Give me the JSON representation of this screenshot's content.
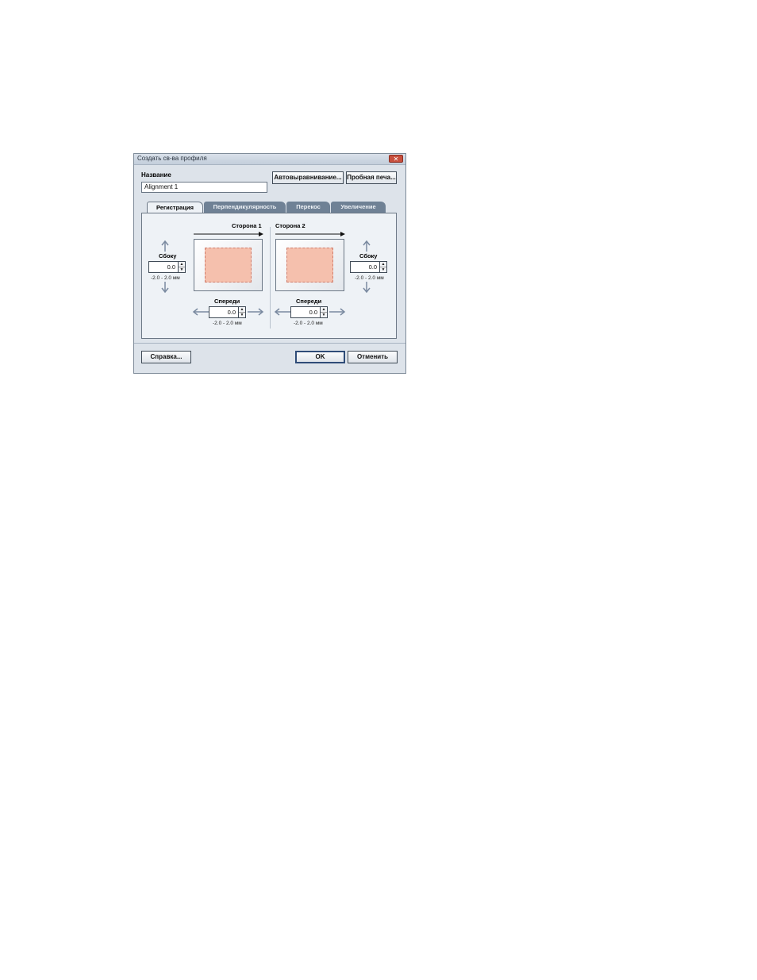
{
  "dialog": {
    "title": "Создать св-ва профиля",
    "close_glyph": "✕"
  },
  "name_field": {
    "label": "Название",
    "value": "Alignment 1"
  },
  "buttons": {
    "auto_align": "Автовыравнивание...",
    "test_print": "Пробная печа...",
    "help": "Справка...",
    "ok": "OK",
    "cancel": "Отменить"
  },
  "tabs": [
    {
      "label": "Регистрация",
      "active": true
    },
    {
      "label": "Перпендикулярность",
      "active": false
    },
    {
      "label": "Перекос",
      "active": false
    },
    {
      "label": "Увеличение",
      "active": false
    }
  ],
  "side1": {
    "title": "Сторона 1",
    "lateral": {
      "label": "Сбоку",
      "value": "0.0",
      "range": "-2.0 - 2.0 мм"
    },
    "lead": {
      "label": "Спереди",
      "value": "0.0",
      "range": "-2.0 - 2.0 мм"
    }
  },
  "side2": {
    "title": "Сторона 2",
    "lateral": {
      "label": "Сбоку",
      "value": "0.0",
      "range": "-2.0 - 2.0 мм"
    },
    "lead": {
      "label": "Спереди",
      "value": "0.0",
      "range": "-2.0 - 2.0 мм"
    }
  },
  "icons": {
    "spin_up": "▲",
    "spin_down": "▼",
    "arrow_up_down": "up-down-arrow-icon",
    "arrow_left_right": "left-right-arrow-icon",
    "feed_direction": "feed-direction-arrow-icon"
  },
  "colors": {
    "image_area": "#f5c0ad",
    "tab_inactive": "#6f8195",
    "panel_bg": "#eef2f6"
  }
}
